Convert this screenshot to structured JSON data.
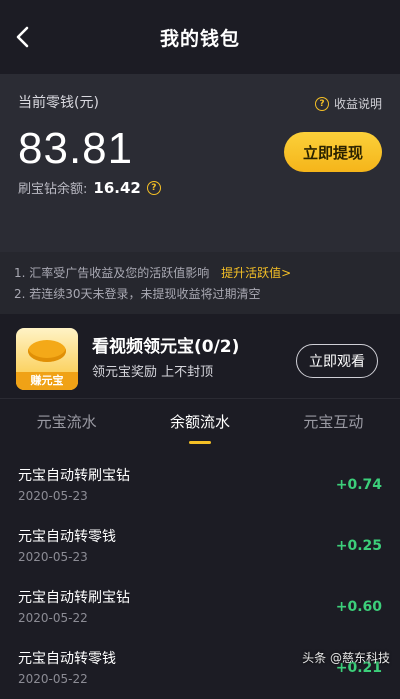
{
  "header": {
    "title": "我的钱包"
  },
  "wallet": {
    "current_label": "当前零钱(元)",
    "help_label": "收益说明",
    "amount": "83.81",
    "withdraw_label": "立即提现",
    "diamond_label": "刷宝钻余额:",
    "diamond_value": "16.42"
  },
  "notes": {
    "line1": "1. 汇率受广告收益及您的活跃值影响",
    "line1_link": "提升活跃值>",
    "line2": "2. 若连续30天未登录，未提现收益将过期清空"
  },
  "task": {
    "image_tag": "赚元宝",
    "title": "看视频领元宝(0/2)",
    "subtitle": "领元宝奖励 上不封顶",
    "button": "立即观看"
  },
  "tabs": [
    {
      "label": "元宝流水"
    },
    {
      "label": "余额流水"
    },
    {
      "label": "元宝互动"
    }
  ],
  "transactions": [
    {
      "name": "元宝自动转刷宝钻",
      "date": "2020-05-23",
      "amount": "+0.74"
    },
    {
      "name": "元宝自动转零钱",
      "date": "2020-05-23",
      "amount": "+0.25"
    },
    {
      "name": "元宝自动转刷宝钻",
      "date": "2020-05-22",
      "amount": "+0.60"
    },
    {
      "name": "元宝自动转零钱",
      "date": "2020-05-22",
      "amount": "+0.21"
    }
  ],
  "watermark": {
    "text": "头条 @慈东科技"
  },
  "colors": {
    "accent": "#f5c026",
    "positive": "#3ccf7a",
    "background": "#1c1c24"
  }
}
